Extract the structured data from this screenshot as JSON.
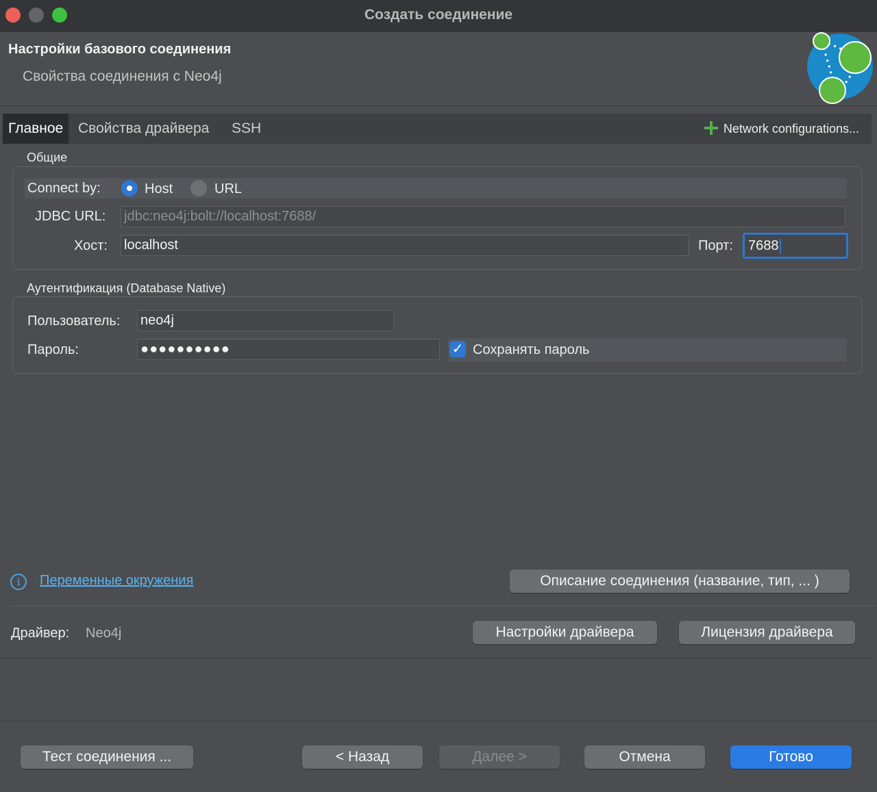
{
  "window": {
    "title": "Создать соединение"
  },
  "header": {
    "title": "Настройки базового соединения",
    "subtitle": "Свойства соединения с Neo4j",
    "logo_icon": "neo4j-logo"
  },
  "tabs": [
    {
      "label": "Главное",
      "active": true
    },
    {
      "label": "Свойства драйвера",
      "active": false
    },
    {
      "label": "SSH",
      "active": false
    }
  ],
  "network_config": {
    "label": "Network configurations...",
    "icon": "plus-icon",
    "icon_color": "#55b04a"
  },
  "general": {
    "section_label": "Общие",
    "connect_by_label": "Connect by:",
    "connect_options": [
      {
        "label": "Host",
        "selected": true
      },
      {
        "label": "URL",
        "selected": false
      }
    ],
    "jdbc_label": "JDBC URL:",
    "jdbc_value": "jdbc:neo4j:bolt://localhost:7688/",
    "host_label": "Хост:",
    "host_value": "localhost",
    "port_label": "Порт:",
    "port_value": "7688"
  },
  "auth": {
    "section_label": "Аутентификация (Database Native)",
    "user_label": "Пользователь:",
    "user_value": "neo4j",
    "password_label": "Пароль:",
    "password_value": "●●●●●●●●●●",
    "save_password_label": "Сохранять пароль",
    "save_password_checked": true
  },
  "env": {
    "icon": "info-icon",
    "link_label": "Переменные окружения"
  },
  "description_button": "Описание соединения (название, тип, ... )",
  "driver": {
    "label": "Драйвер:",
    "value": "Neo4j",
    "settings_button": "Настройки драйвера",
    "license_button": "Лицензия драйвера"
  },
  "footer": {
    "test_button": "Тест соединения ...",
    "back_button": "< Назад",
    "next_button": "Далее >",
    "cancel_button": "Отмена",
    "finish_button": "Готово"
  },
  "colors": {
    "accent": "#2a7be3",
    "link": "#5ab2f0",
    "background": "#4b4d50"
  }
}
